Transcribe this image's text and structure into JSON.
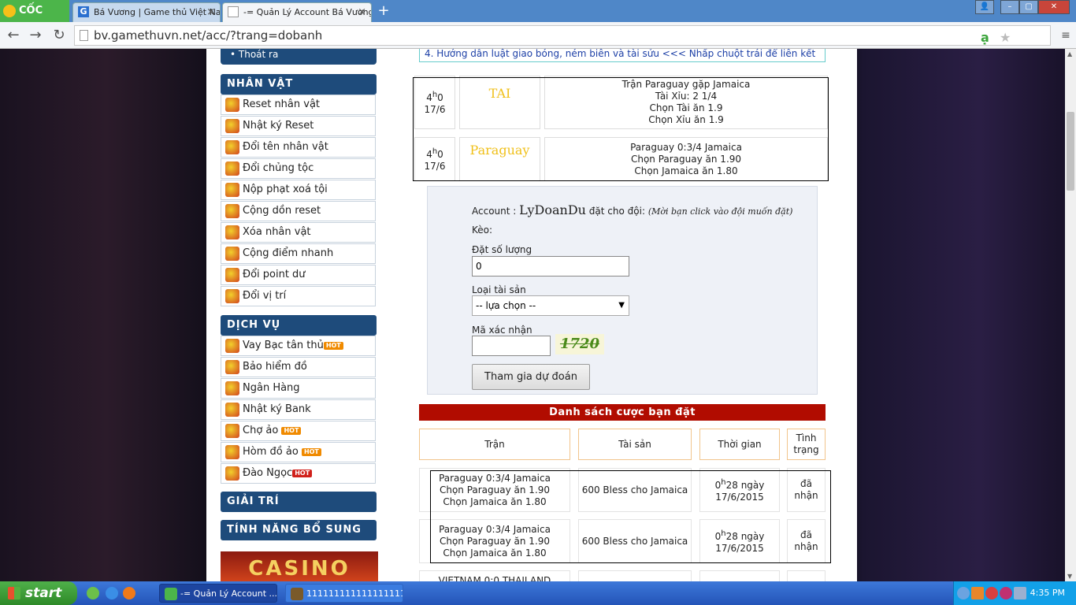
{
  "browser": {
    "brand": "CỐC CỐC",
    "tabs": [
      {
        "title": "Bá Vương | Game thủ Việt Nam"
      },
      {
        "title": "-= Quản Lý Account Bá Vương =-"
      }
    ],
    "url": "bv.gamethuvn.net/acc/?trang=dobanh"
  },
  "sidebar": {
    "top_item": "Thoát ra",
    "sections": [
      {
        "title": "NHÂN VẬT",
        "items": [
          "Reset nhân vật",
          "Nhật ký Reset",
          "Đổi tên nhân vật",
          "Đổi chủng tộc",
          "Nộp phạt xoá tội",
          "Cộng dồn reset",
          "Xóa nhân vật",
          "Cộng điểm nhanh",
          "Đổi point dư",
          "Đổi vị trí"
        ]
      },
      {
        "title": "DỊCH VỤ",
        "items": [
          "Vay Bạc tân thủ",
          "Bảo hiểm đồ",
          "Ngân Hàng",
          "Nhật ký Bank",
          "Chợ ảo",
          "Hòm đồ ảo",
          "Đào Ngọc"
        ]
      },
      {
        "title": "GIẢI TRÍ",
        "items": []
      },
      {
        "title": "TÍNH NĂNG BỔ SUNG",
        "items": []
      }
    ],
    "hot_badge": "HOT",
    "casino_label": "CASINO"
  },
  "notice": "4. Hướng dẫn luật giao bóng, ném biên và tài sửu <<< Nhấp chuột trái để liên kết",
  "matches": [
    {
      "time_h": "4",
      "time_m": "0",
      "date": "17/6",
      "pick": "TAI",
      "lines": [
        "Trận Paraguay gặp Jamaica",
        "Tài Xỉu: 2 1/4",
        "Chọn Tài ăn 1.9",
        "Chọn Xỉu ăn 1.9"
      ]
    },
    {
      "time_h": "4",
      "time_m": "0",
      "date": "17/6",
      "pick": "Paraguay",
      "lines": [
        "Paraguay 0:3/4 Jamaica",
        "Chọn Paraguay ăn 1.90",
        "Chọn Jamaica ăn 1.80"
      ]
    }
  ],
  "form": {
    "account_prefix": "Account :",
    "account_name": "LyDoanDu",
    "account_suffix": "đặt cho đội:",
    "hint": "(Mời bạn click vào đội muốn đặt)",
    "keo_label": "Kèo:",
    "qty_label": "Đặt số lượng",
    "qty_value": "0",
    "asset_label": "Loại tài sản",
    "asset_value": "-- lựa chọn --",
    "captcha_label": "Mã xác nhận",
    "captcha_text": "1720",
    "submit": "Tham gia dự đoán"
  },
  "bets": {
    "title": "Danh sách cược bạn đặt",
    "headers": [
      "Trận",
      "Tài sản",
      "Thời gian",
      "Tình trạng"
    ],
    "rows": [
      {
        "match": [
          "Paraguay 0:3/4 Jamaica",
          "Chọn Paraguay ăn 1.90",
          "Chọn Jamaica ăn 1.80"
        ],
        "asset": "600 Bless cho Jamaica",
        "time_h": "0",
        "time_rest": "28 ngày",
        "date": "17/6/2015",
        "status": "đã nhận"
      },
      {
        "match": [
          "Paraguay 0:3/4 Jamaica",
          "Chọn Paraguay ăn 1.90",
          "Chọn Jamaica ăn 1.80"
        ],
        "asset": "600 Bless cho Jamaica",
        "time_h": "0",
        "time_rest": "28 ngày",
        "date": "17/6/2015",
        "status": "đã nhận"
      },
      {
        "match": [
          "VIETNAM 0:0 THAILAND"
        ],
        "asset": "",
        "time_h": "",
        "time_rest": "",
        "date": "",
        "status": ""
      }
    ]
  },
  "taskbar": {
    "start": "start",
    "tasks": [
      "-= Quản Lý Account ...",
      "1111111111111111111..."
    ],
    "clock": "4:35 PM"
  }
}
